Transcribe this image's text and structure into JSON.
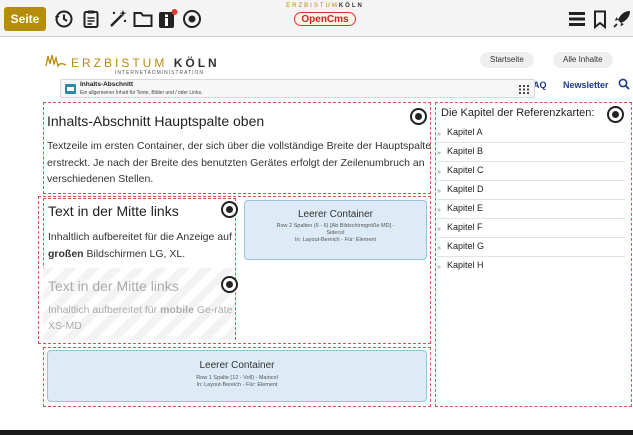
{
  "toolbar": {
    "seite_label": "Seite",
    "icons": [
      "history-icon",
      "clipboard-icon",
      "magic-wand-icon",
      "folder-icon",
      "info-icon",
      "target-icon",
      "menu-icon",
      "bookmark-icon",
      "rocket-icon"
    ],
    "logo_top_prefix": "ERZBISTUM",
    "logo_top_suffix": "KÖLN",
    "logo_pill": "OpenCms"
  },
  "brand": {
    "word_prefix": "ERZBISTUM",
    "word_suffix": "KÖLN",
    "sub": "INTERNETADMINISTRATION"
  },
  "nav": {
    "startseite": "Startseite",
    "alle_inhalte": "Alle Inhalte",
    "aq": "AQ",
    "newsletter": "Newsletter"
  },
  "type_bar": {
    "title": "Inhalts-Abschnitt",
    "subtitle": "Ein allgemeiner Inhalt für Texte, Bilder und / oder Links."
  },
  "main_top": {
    "heading": "Inhalts-Abschnitt Hauptspalte oben",
    "text": "Textzeile im ersten Container, der sich über die vollständige Breite der Hauptspalte erstreckt. Je nach der Breite des benutzten Gerätes erfolgt der Zeilenumbruch an verschiedenen Stellen."
  },
  "mid_left": {
    "heading": "Text in der Mitte links",
    "text_pre": "Inhaltlich aufbereitet für die Anzeige auf ",
    "text_bold": "großen",
    "text_post": " Bildschirmen LG, XL."
  },
  "mid_left2": {
    "heading": "Text in der Mitte links",
    "text_pre": "Inhaltlich aufbereitet für ",
    "text_bold": "mobile",
    "text_post": " Ge-räte XS-MD"
  },
  "empty_right": {
    "title": "Leerer Container",
    "line1": "Row 2 Spalten (6 - 6) [Ab Bildschirmgröße MD] -",
    "line2": "Sidecol",
    "line3": "In: Layout-Bereich - Für: Element"
  },
  "empty_bottom": {
    "title": "Leerer Container",
    "line1": "Row 1 Spalte (12 - Voll) - Maincol",
    "line2": "In: Layout-Bereich - Für: Element"
  },
  "sidebar": {
    "title": "Die Kapitel der Referenzkarten:",
    "items": [
      "Kapitel A",
      "Kapitel B",
      "Kapitel C",
      "Kapitel D",
      "Kapitel E",
      "Kapitel F",
      "Kapitel G",
      "Kapitel H"
    ]
  },
  "colors": {
    "seite_button": "#b58d0a",
    "dropzone_border": "#d9534f",
    "empty_container": "#dcebf5",
    "nav_link": "#1b3a8a"
  }
}
